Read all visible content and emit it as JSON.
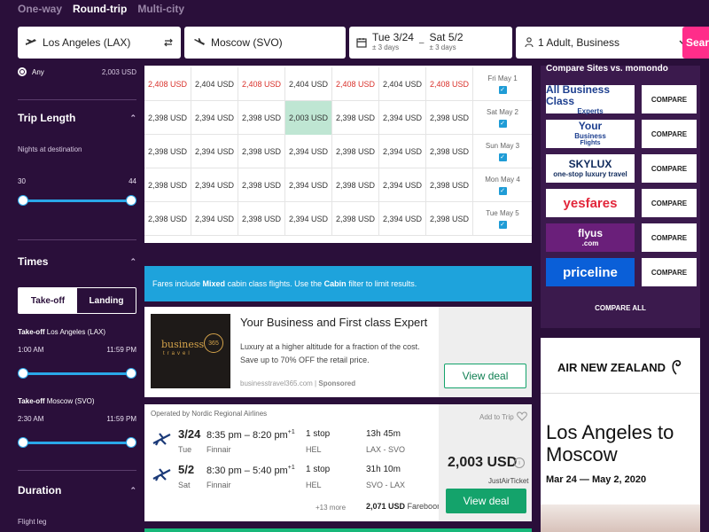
{
  "trip_tabs": [
    {
      "label": "One-way",
      "active": false
    },
    {
      "label": "Round-trip",
      "active": true
    },
    {
      "label": "Multi-city",
      "active": false
    }
  ],
  "search": {
    "origin": "Los Angeles (LAX)",
    "destination": "Moscow (SVO)",
    "depart_date": "Tue 3/24",
    "depart_flex": "± 3 days",
    "return_date": "Sat 5/2",
    "return_flex": "± 3 days",
    "passengers": "1 Adult, Business",
    "button": "Search"
  },
  "sidebar": {
    "any": {
      "label": "Any",
      "price": "2,003 USD"
    },
    "trip_length": {
      "title": "Trip Length",
      "sub": "Nights at destination",
      "min": "30",
      "max": "44",
      "low_fraction": 0,
      "high_fraction": 1
    },
    "times": {
      "title": "Times",
      "toggle_takeoff": "Take-off",
      "toggle_landing": "Landing",
      "leg1_prefix": "Take-off",
      "leg1_city": "Los Angeles (LAX)",
      "leg1_min": "1:00 AM",
      "leg1_max": "11:59 PM",
      "leg2_prefix": "Take-off",
      "leg2_city": "Moscow (SVO)",
      "leg2_min": "2:30 AM",
      "leg2_max": "11:59 PM"
    },
    "duration": {
      "title": "Duration",
      "sub": "Flight leg"
    }
  },
  "matrix": {
    "rows": [
      {
        "label": "Fri May 1",
        "cells": [
          {
            "v": "2,408 USD",
            "red": true
          },
          {
            "v": "2,404 USD"
          },
          {
            "v": "2,408 USD",
            "red": true
          },
          {
            "v": "2,404 USD"
          },
          {
            "v": "2,408 USD",
            "red": true
          },
          {
            "v": "2,404 USD"
          },
          {
            "v": "2,408 USD",
            "red": true
          }
        ]
      },
      {
        "label": "Sat May 2",
        "cells": [
          {
            "v": "2,398 USD"
          },
          {
            "v": "2,394 USD"
          },
          {
            "v": "2,398 USD"
          },
          {
            "v": "2,003 USD",
            "best": true
          },
          {
            "v": "2,398 USD"
          },
          {
            "v": "2,394 USD"
          },
          {
            "v": "2,398 USD"
          }
        ]
      },
      {
        "label": "Sun May 3",
        "cells": [
          {
            "v": "2,398 USD"
          },
          {
            "v": "2,394 USD"
          },
          {
            "v": "2,398 USD"
          },
          {
            "v": "2,394 USD"
          },
          {
            "v": "2,398 USD"
          },
          {
            "v": "2,394 USD"
          },
          {
            "v": "2,398 USD"
          }
        ]
      },
      {
        "label": "Mon May 4",
        "cells": [
          {
            "v": "2,398 USD"
          },
          {
            "v": "2,394 USD"
          },
          {
            "v": "2,398 USD"
          },
          {
            "v": "2,394 USD"
          },
          {
            "v": "2,398 USD"
          },
          {
            "v": "2,394 USD"
          },
          {
            "v": "2,398 USD"
          }
        ]
      },
      {
        "label": "Tue May 5",
        "cells": [
          {
            "v": "2,398 USD"
          },
          {
            "v": "2,394 USD"
          },
          {
            "v": "2,398 USD"
          },
          {
            "v": "2,394 USD"
          },
          {
            "v": "2,398 USD"
          },
          {
            "v": "2,394 USD"
          },
          {
            "v": "2,398 USD"
          }
        ]
      }
    ]
  },
  "banner": {
    "t1": "Fares include ",
    "b1": "Mixed",
    "t2": " cabin class flights. Use the ",
    "b2": "Cabin",
    "t3": " filter to limit results."
  },
  "ad": {
    "logo_word": "business",
    "logo_sub": "travel",
    "logo_num": "365",
    "title": "Your Business and First class Expert",
    "desc": "Luxury at a higher altitude for a fraction of the cost. Save up to 70% OFF the retail price.",
    "source": "businesstravel365.com",
    "sep": " | ",
    "sponsored": "Sponsored",
    "cta": "View deal"
  },
  "result": {
    "operated": "Operated by Nordic Regional Airlines",
    "legs": [
      {
        "date": "3/24",
        "dow": "Tue",
        "times": "8:35 pm – 8:20 pm",
        "plus": "+1",
        "airline": "Finnair",
        "stops": "1 stop",
        "via": "HEL",
        "duration": "13h 45m",
        "route": "LAX - SVO"
      },
      {
        "date": "5/2",
        "dow": "Sat",
        "times": "8:30 pm – 5:40 pm",
        "plus": "+1",
        "airline": "Finnair",
        "stops": "1 stop",
        "via": "HEL",
        "duration": "31h 10m",
        "route": "SVO - LAX"
      }
    ],
    "more": "+13 more",
    "fare_price": "2,071 USD",
    "fare_name": "Fareboom",
    "add_trip": "Add to Trip",
    "price": "2,003 USD",
    "provider": "JustAirTicket",
    "cta": "View deal"
  },
  "compare": {
    "title": "Compare Sites vs. momondo",
    "items": [
      {
        "name": "All Business Class Experts",
        "line1": "All Business Class",
        "line2": "Experts",
        "bg": "#ffffff",
        "fg": "#1d3f8f",
        "button": "COMPARE"
      },
      {
        "name": "Your Business Flights",
        "line1": "Your",
        "line2": "Business",
        "line3": "Flights",
        "bg": "#ffffff",
        "fg": "#1d3f8f",
        "button": "COMPARE"
      },
      {
        "name": "SKYLUX",
        "line1": "SKYLUX",
        "line2": "one-stop luxury travel",
        "bg": "#ffffff",
        "fg": "#0f2a5c",
        "button": "COMPARE"
      },
      {
        "name": "yesfares",
        "line1": "yesfares",
        "bg": "#ffffff",
        "fg": "#e2263a",
        "button": "COMPARE"
      },
      {
        "name": "flyus.com",
        "line1": "flyus",
        "line2": ".com",
        "bg": "#6a1f7a",
        "fg": "#ffffff",
        "button": "COMPARE"
      },
      {
        "name": "priceline",
        "line1": "priceline",
        "bg": "#0a5fd8",
        "fg": "#ffffff",
        "button": "COMPARE"
      }
    ],
    "compare_all": "COMPARE ALL"
  },
  "airline_ad": {
    "brand": "AIR NEW ZEALAND",
    "headline": "Los Angeles to Moscow",
    "dates": "Mar 24 — May 2, 2020"
  },
  "colors": {
    "accent_pink": "#ff2d8a",
    "info_blue": "#1ea3dc",
    "deal_green": "#14a36b",
    "price_red": "#d9312b",
    "bg_purple": "#2a0f3a"
  }
}
